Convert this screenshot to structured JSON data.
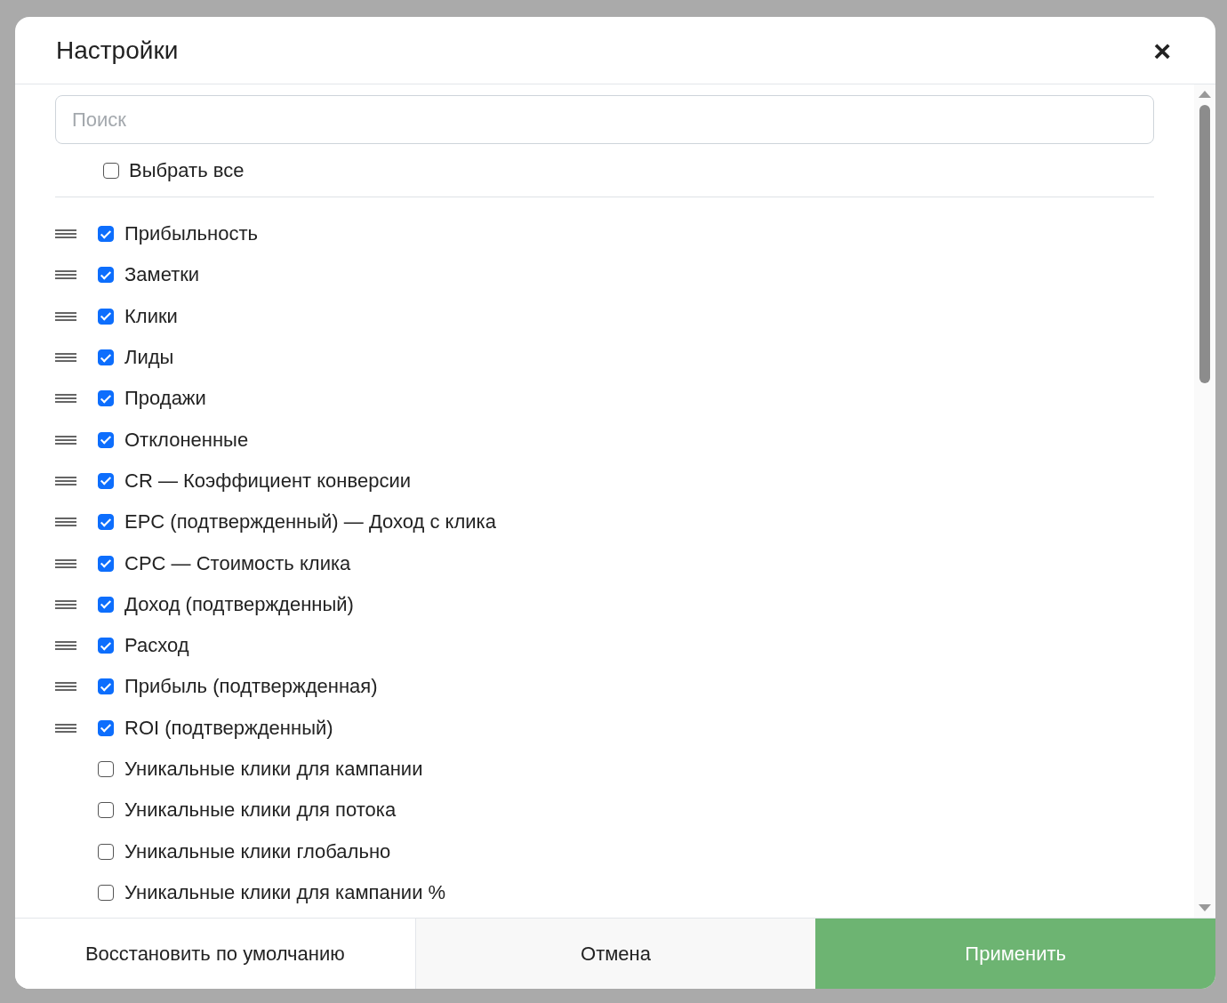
{
  "dialog": {
    "title": "Настройки",
    "close": "×"
  },
  "search": {
    "placeholder": "Поиск"
  },
  "select_all": {
    "label": "Выбрать все",
    "checked": false
  },
  "columns": [
    {
      "label": "Прибыльность",
      "checked": true,
      "kind": "sortable"
    },
    {
      "label": "Заметки",
      "checked": true,
      "kind": "sortable"
    },
    {
      "label": "Клики",
      "checked": true,
      "kind": "sortable"
    },
    {
      "label": "Лиды",
      "checked": true,
      "kind": "sortable"
    },
    {
      "label": "Продажи",
      "checked": true,
      "kind": "sortable"
    },
    {
      "label": "Отклоненные",
      "checked": true,
      "kind": "sortable"
    },
    {
      "label": "CR — Коэффициент конверсии",
      "checked": true,
      "kind": "sortable"
    },
    {
      "label": "EPC (подтвержденный) — Доход с клика",
      "checked": true,
      "kind": "sortable"
    },
    {
      "label": "CPC — Стоимость клика",
      "checked": true,
      "kind": "sortable"
    },
    {
      "label": "Доход (подтвержденный)",
      "checked": true,
      "kind": "sortable"
    },
    {
      "label": "Расход",
      "checked": true,
      "kind": "sortable"
    },
    {
      "label": "Прибыль (подтвержденная)",
      "checked": true,
      "kind": "sortable"
    },
    {
      "label": "ROI (подтвержденный)",
      "checked": true,
      "kind": "sortable"
    },
    {
      "label": "Уникальные клики для кампании",
      "checked": false,
      "kind": "plain"
    },
    {
      "label": "Уникальные клики для потока",
      "checked": false,
      "kind": "plain"
    },
    {
      "label": "Уникальные клики глобально",
      "checked": false,
      "kind": "plain"
    },
    {
      "label": "Уникальные клики для кампании %",
      "checked": false,
      "kind": "plain"
    }
  ],
  "buttons": [
    {
      "label": "Восстановить по умолчанию",
      "kind": "reset"
    },
    {
      "label": "Отмена",
      "kind": "cancel"
    },
    {
      "label": "Применить",
      "kind": "apply"
    }
  ]
}
